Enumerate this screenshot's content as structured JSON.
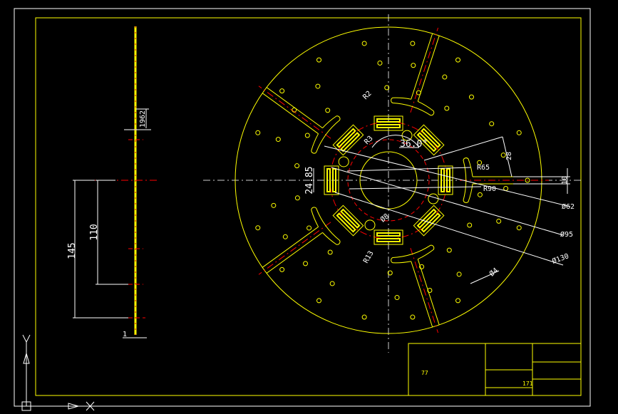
{
  "drawing": {
    "colors": {
      "background": "#000000",
      "geometry": "#ffff00",
      "centerline": "#ff0000",
      "dimension": "#ffffff",
      "frame": "#ffffff"
    },
    "side_view": {
      "dims": {
        "thickness_top": "1962",
        "height_outer": "145",
        "height_inner": "110",
        "thickness": "1"
      }
    },
    "front_view": {
      "dims": {
        "radius_small": "R2",
        "radius_window": "R3",
        "angle": "36.0°",
        "window_width": "24.85",
        "r65": "R65",
        "r90": "R90",
        "d62": "Ø62",
        "d95": "Ø95",
        "d130": "Ø130",
        "slot_len": "28",
        "slot_width": "10",
        "d8": "Ø8",
        "r13": "R13",
        "d4": "Ø4"
      }
    },
    "title_block": {
      "cell_a": "77",
      "cell_b": "171"
    },
    "ucs_icon": "ucs-axis-icon"
  }
}
